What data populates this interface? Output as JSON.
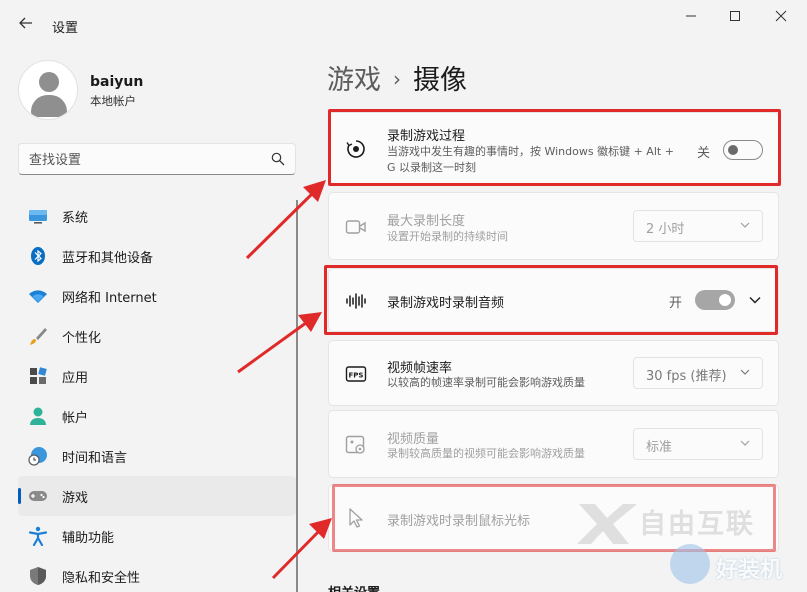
{
  "window": {
    "title": "设置",
    "back_icon": "arrow-left-icon",
    "minimize": "—",
    "maximize": "☐",
    "close": "✕"
  },
  "profile": {
    "name": "baiyun",
    "account_type": "本地帐户"
  },
  "search": {
    "placeholder": "查找设置"
  },
  "sidebar": {
    "items": [
      {
        "label": "系统",
        "icon": "monitor-icon"
      },
      {
        "label": "蓝牙和其他设备",
        "icon": "bluetooth-icon"
      },
      {
        "label": "网络和 Internet",
        "icon": "wifi-icon"
      },
      {
        "label": "个性化",
        "icon": "brush-icon"
      },
      {
        "label": "应用",
        "icon": "apps-icon"
      },
      {
        "label": "帐户",
        "icon": "person-icon"
      },
      {
        "label": "时间和语言",
        "icon": "globe-clock-icon"
      },
      {
        "label": "游戏",
        "icon": "gamepad-icon",
        "active": true
      },
      {
        "label": "辅助功能",
        "icon": "accessibility-icon"
      },
      {
        "label": "隐私和安全性",
        "icon": "shield-icon"
      }
    ]
  },
  "breadcrumb": {
    "parent": "游戏",
    "separator": "›",
    "current": "摄像"
  },
  "settings": {
    "record_game": {
      "title": "录制游戏过程",
      "desc": "当游戏中发生有趣的事情时，按 Windows 徽标键 + Alt + G 以录制这一时刻",
      "state_label": "关",
      "on": false
    },
    "max_length": {
      "title": "最大录制长度",
      "desc": "设置开始录制的持续时间",
      "value": "2 小时"
    },
    "record_audio": {
      "title": "录制游戏时录制音频",
      "state_label": "开",
      "on": true
    },
    "frame_rate": {
      "title": "视频帧速率",
      "desc": "以较高的帧速率录制可能会影响游戏质量",
      "value": "30 fps (推荐)"
    },
    "video_quality": {
      "title": "视频质量",
      "desc": "录制较高质量的视频可能会影响游戏质量",
      "value": "标准"
    },
    "record_cursor": {
      "title": "录制游戏时录制鼠标光标"
    }
  },
  "related": {
    "heading": "相关设置"
  },
  "watermarks": {
    "main": "自由互联",
    "secondary": "好装机"
  },
  "colors": {
    "accent": "#005fb8",
    "highlight": "#e02a2a"
  }
}
